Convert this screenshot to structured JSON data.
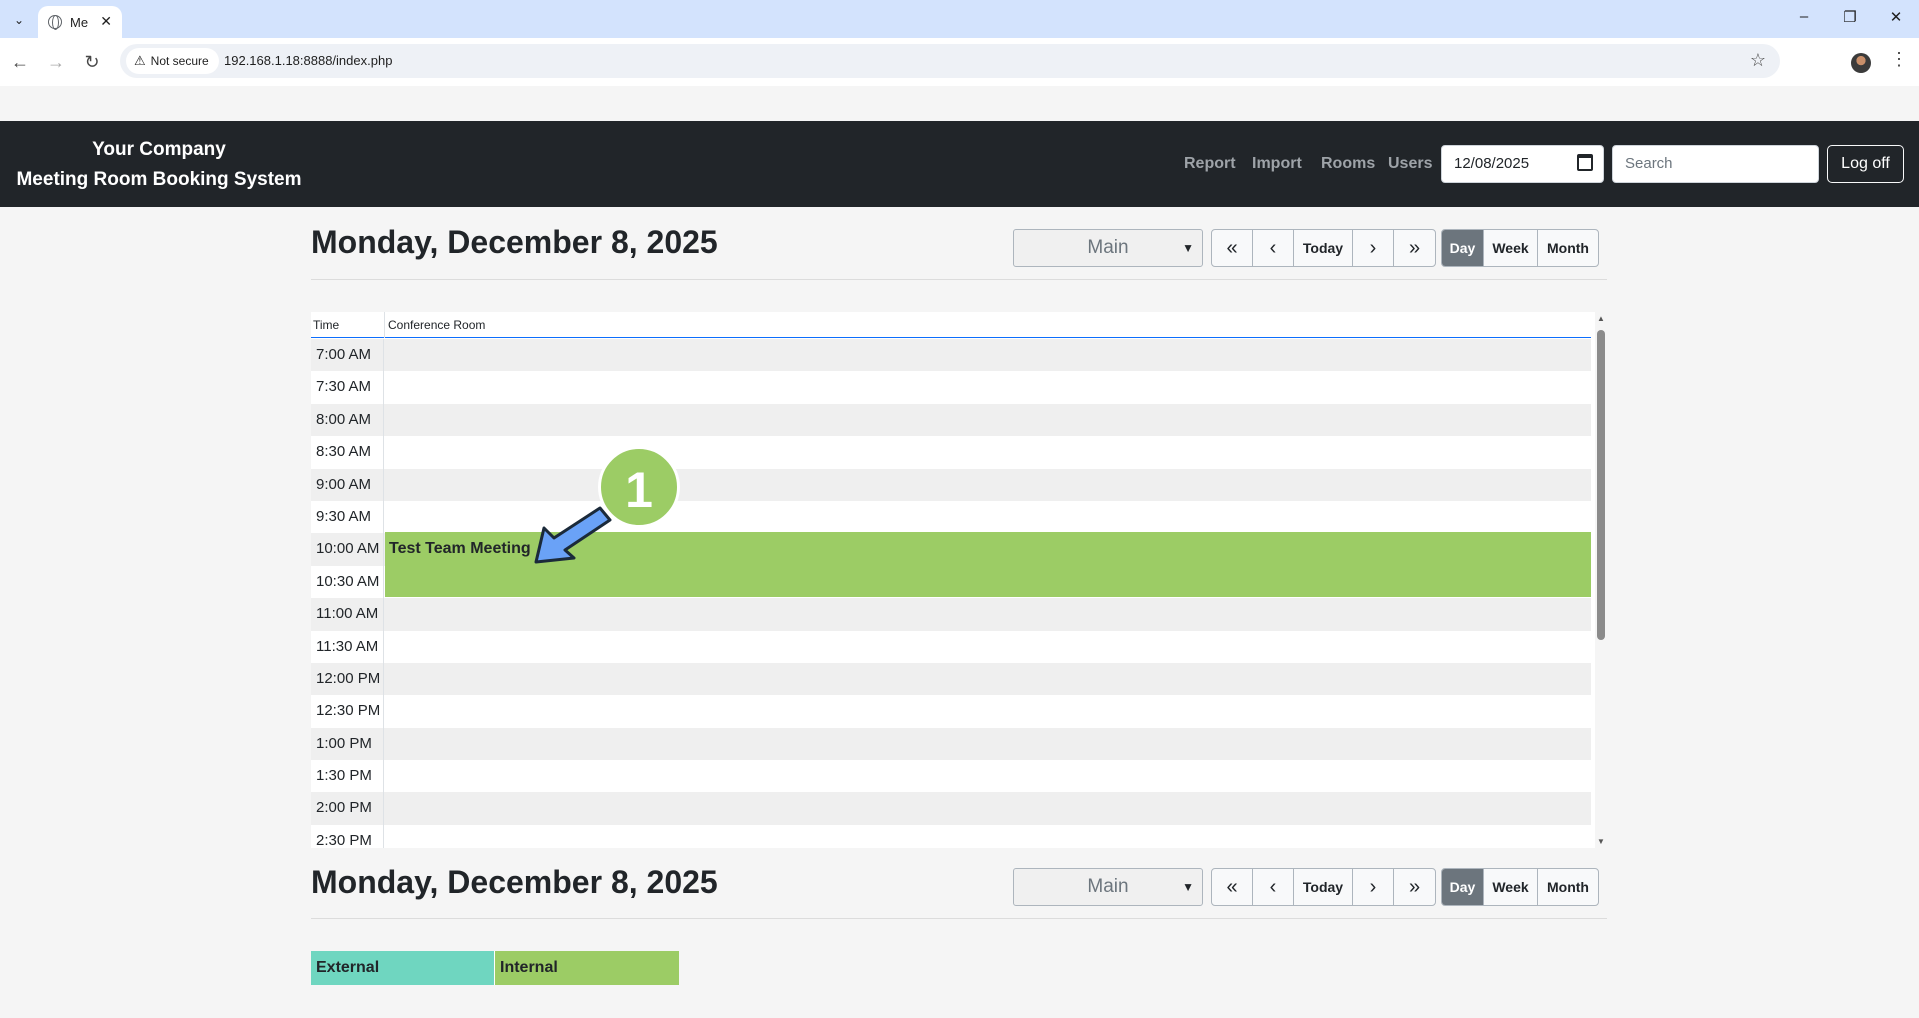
{
  "browser": {
    "tab_title": "Me",
    "security_label": "Not secure",
    "url": "192.168.1.18:8888/index.php"
  },
  "header": {
    "company": "Your Company",
    "system_name": "Meeting Room Booking System",
    "nav": [
      "Report",
      "Import",
      "Rooms",
      "Users"
    ],
    "date_value": "12/08/2025",
    "search_placeholder": "Search",
    "logoff_label": "Log off"
  },
  "page": {
    "day_title": "Monday, December 8, 2025",
    "area_selected": "Main",
    "nav_buttons": {
      "first": "«",
      "prev": "‹",
      "today": "Today",
      "next": "›",
      "last": "»"
    },
    "view_buttons": {
      "day": "Day",
      "week": "Week",
      "month": "Month",
      "active": "Day"
    }
  },
  "grid": {
    "time_header": "Time",
    "room_header": "Conference Room",
    "times": [
      "7:00 AM",
      "7:30 AM",
      "8:00 AM",
      "8:30 AM",
      "9:00 AM",
      "9:30 AM",
      "10:00 AM",
      "10:30 AM",
      "11:00 AM",
      "11:30 AM",
      "12:00 PM",
      "12:30 PM",
      "1:00 PM",
      "1:30 PM",
      "2:00 PM",
      "2:30 PM"
    ],
    "booking": {
      "title": "Test Team Meeting",
      "start": "10:00 AM",
      "end": "11:00 AM",
      "color": "#9ccc65"
    }
  },
  "annotation": {
    "number": "1"
  },
  "legend": [
    {
      "label": "External",
      "color": "#6fd6c0"
    },
    {
      "label": "Internal",
      "color": "#9ccc65"
    }
  ]
}
